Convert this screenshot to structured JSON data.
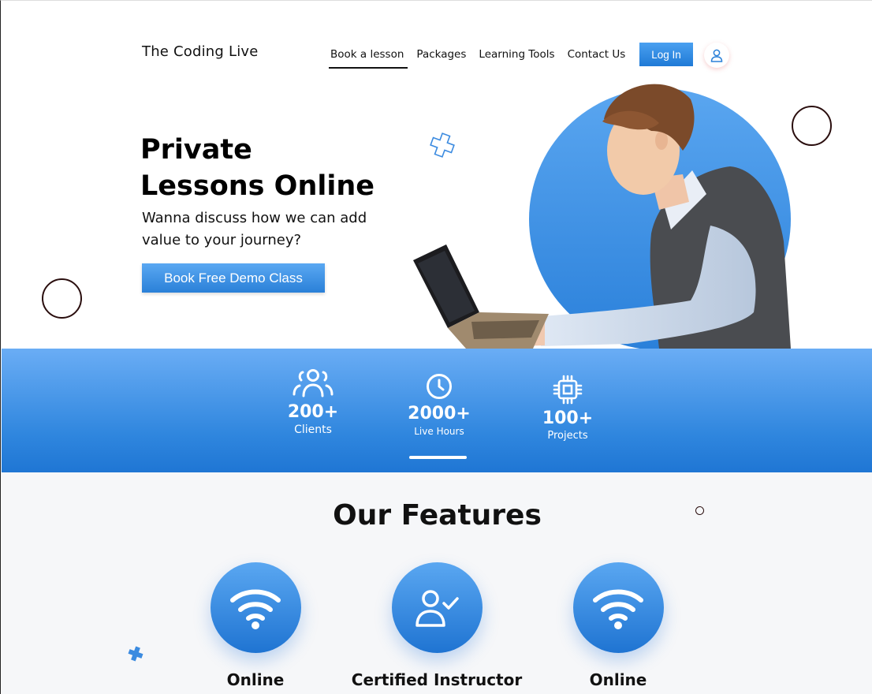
{
  "header": {
    "brand": "The Coding Live",
    "nav": [
      "Book a lesson",
      "Packages",
      "Learning Tools",
      "Contact Us"
    ],
    "active_nav": "Book a lesson",
    "login_label": "Log In",
    "user_icon": "user-icon"
  },
  "hero": {
    "title_line1": "Private",
    "title_line2": "Lessons Online",
    "subtitle": "Wanna discuss how we can add value to your journey?",
    "cta_label": "Book Free Demo Class"
  },
  "stats": [
    {
      "icon": "users-icon",
      "value": "200+",
      "label": "Clients"
    },
    {
      "icon": "clock-icon",
      "value": "2000+",
      "label": "Live Hours"
    },
    {
      "icon": "chip-icon",
      "value": "100+",
      "label": "Projects"
    }
  ],
  "features": {
    "title": "Our Features",
    "items": [
      {
        "icon": "wifi-icon",
        "title": "Online"
      },
      {
        "icon": "certified-user-icon",
        "title": "Certified Instructor"
      },
      {
        "icon": "wifi-icon",
        "title": "Online"
      }
    ]
  },
  "colors": {
    "accent": "#2f86de",
    "accent_light": "#6aadf5",
    "ring": "#2a0e0e",
    "features_bg": "#f6f7f9"
  }
}
